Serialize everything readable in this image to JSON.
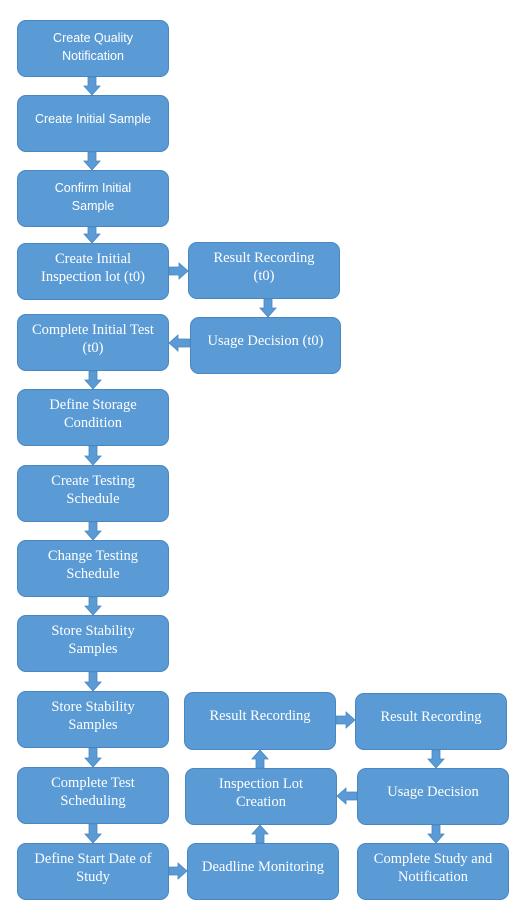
{
  "diagram": {
    "type": "flowchart",
    "colors": {
      "box_fill": "#5b9bd5",
      "box_border": "#4a86c0",
      "text": "#ffffff",
      "arrow": "#5b9bd5"
    },
    "nodes": [
      {
        "id": "n1",
        "label": "Create Quality Notification",
        "lines": [
          "Create Quality",
          "Notification"
        ]
      },
      {
        "id": "n2",
        "label": "Create Initial Sample",
        "lines": [
          "Create Initial Sample"
        ]
      },
      {
        "id": "n3",
        "label": "Confirm Initial Sample",
        "lines": [
          "Confirm Initial",
          "Sample"
        ]
      },
      {
        "id": "n4",
        "label": "Create Initial Inspection lot (t0)",
        "lines": [
          "Create Initial",
          "Inspection lot (t0)"
        ]
      },
      {
        "id": "n5",
        "label": "Result Recording (t0)",
        "lines": [
          "Result Recording",
          "(t0)"
        ]
      },
      {
        "id": "n6",
        "label": "Usage Decision (t0)",
        "lines": [
          "Usage Decision (t0)"
        ]
      },
      {
        "id": "n7",
        "label": "Complete Initial Test (t0)",
        "lines": [
          "Complete Initial Test",
          "(t0)"
        ]
      },
      {
        "id": "n8",
        "label": "Define Storage Condition",
        "lines": [
          "Define Storage",
          "Condition"
        ]
      },
      {
        "id": "n9",
        "label": "Create Testing Schedule",
        "lines": [
          "Create Testing",
          "Schedule"
        ]
      },
      {
        "id": "n10",
        "label": "Change Testing Schedule",
        "lines": [
          "Change Testing",
          "Schedule"
        ]
      },
      {
        "id": "n11",
        "label": "Store Stability Samples",
        "lines": [
          "Store Stability",
          "Samples"
        ]
      },
      {
        "id": "n12",
        "label": "Store Stability Samples",
        "lines": [
          "Store Stability",
          "Samples"
        ]
      },
      {
        "id": "n13",
        "label": "Complete Test Scheduling",
        "lines": [
          "Complete Test",
          "Scheduling"
        ]
      },
      {
        "id": "n14",
        "label": "Define Start Date of Study",
        "lines": [
          "Define Start Date of",
          "Study"
        ]
      },
      {
        "id": "n15",
        "label": "Deadline Monitoring",
        "lines": [
          "Deadline Monitoring"
        ]
      },
      {
        "id": "n16",
        "label": "Inspection Lot Creation",
        "lines": [
          "Inspection Lot",
          "Creation"
        ]
      },
      {
        "id": "n17",
        "label": "Result Recording",
        "lines": [
          "Result Recording"
        ]
      },
      {
        "id": "n18",
        "label": "Result Recording",
        "lines": [
          "Result Recording"
        ]
      },
      {
        "id": "n19",
        "label": "Usage Decision",
        "lines": [
          "Usage Decision"
        ]
      },
      {
        "id": "n20",
        "label": "Complete Study and Notification",
        "lines": [
          "Complete Study and",
          "Notification"
        ]
      }
    ],
    "edges": [
      {
        "from": "n1",
        "to": "n2"
      },
      {
        "from": "n2",
        "to": "n3"
      },
      {
        "from": "n3",
        "to": "n4"
      },
      {
        "from": "n4",
        "to": "n5"
      },
      {
        "from": "n5",
        "to": "n6"
      },
      {
        "from": "n6",
        "to": "n7"
      },
      {
        "from": "n7",
        "to": "n8"
      },
      {
        "from": "n8",
        "to": "n9"
      },
      {
        "from": "n9",
        "to": "n10"
      },
      {
        "from": "n10",
        "to": "n11"
      },
      {
        "from": "n11",
        "to": "n12"
      },
      {
        "from": "n12",
        "to": "n13"
      },
      {
        "from": "n13",
        "to": "n14"
      },
      {
        "from": "n14",
        "to": "n15"
      },
      {
        "from": "n15",
        "to": "n16"
      },
      {
        "from": "n16",
        "to": "n17"
      },
      {
        "from": "n17",
        "to": "n18"
      },
      {
        "from": "n18",
        "to": "n19"
      },
      {
        "from": "n19",
        "to": "n16"
      },
      {
        "from": "n19",
        "to": "n20"
      }
    ]
  }
}
